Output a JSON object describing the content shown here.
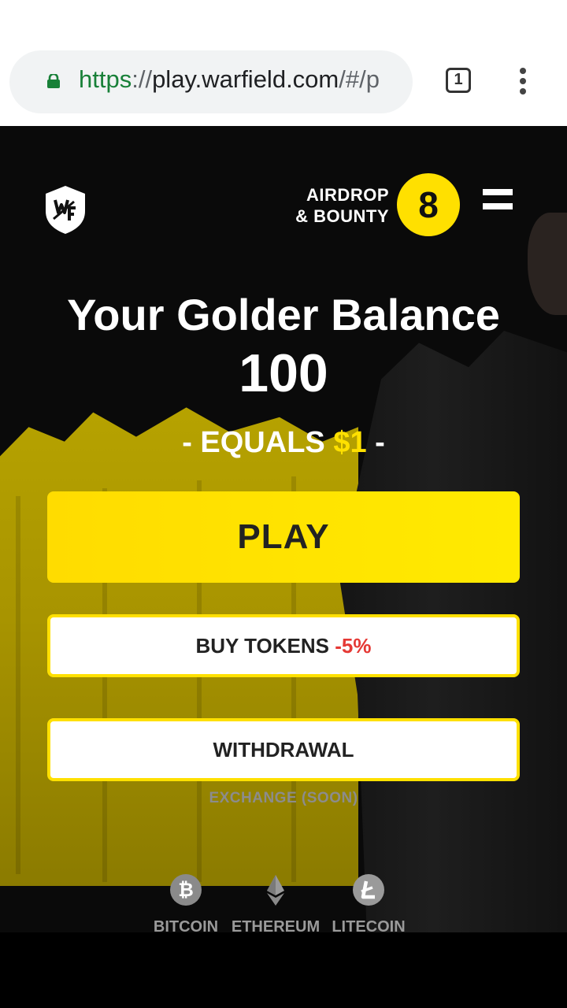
{
  "browser": {
    "url_scheme": "https",
    "url_separator": "://",
    "url_host": "play.warfield.com",
    "url_path": "/#/p",
    "tab_count": "1"
  },
  "header": {
    "logo_icon": "warfield-shield-icon",
    "airdrop_line1": "AIRDROP",
    "airdrop_line2": "& BOUNTY",
    "airdrop_count": "8",
    "menu_icon": "hamburger-menu-icon"
  },
  "balance": {
    "title": "Your Golder Balance",
    "value": "100",
    "equals_prefix": "- EQUALS ",
    "equals_amount": "$1",
    "equals_suffix": " -"
  },
  "actions": {
    "play_label": "PLAY",
    "buy_label": "BUY TOKENS ",
    "buy_discount": "-5%",
    "withdraw_label": "WITHDRAWAL",
    "exchange_label": "EXCHANGE (SOON)"
  },
  "coins": [
    {
      "label": "BITCOIN",
      "icon": "bitcoin-icon"
    },
    {
      "label": "ETHEREUM",
      "icon": "ethereum-icon"
    },
    {
      "label": "LITECOIN",
      "icon": "litecoin-icon"
    }
  ],
  "colors": {
    "accent_yellow": "#ffe000",
    "discount_red": "#e53935",
    "url_green": "#188038"
  }
}
